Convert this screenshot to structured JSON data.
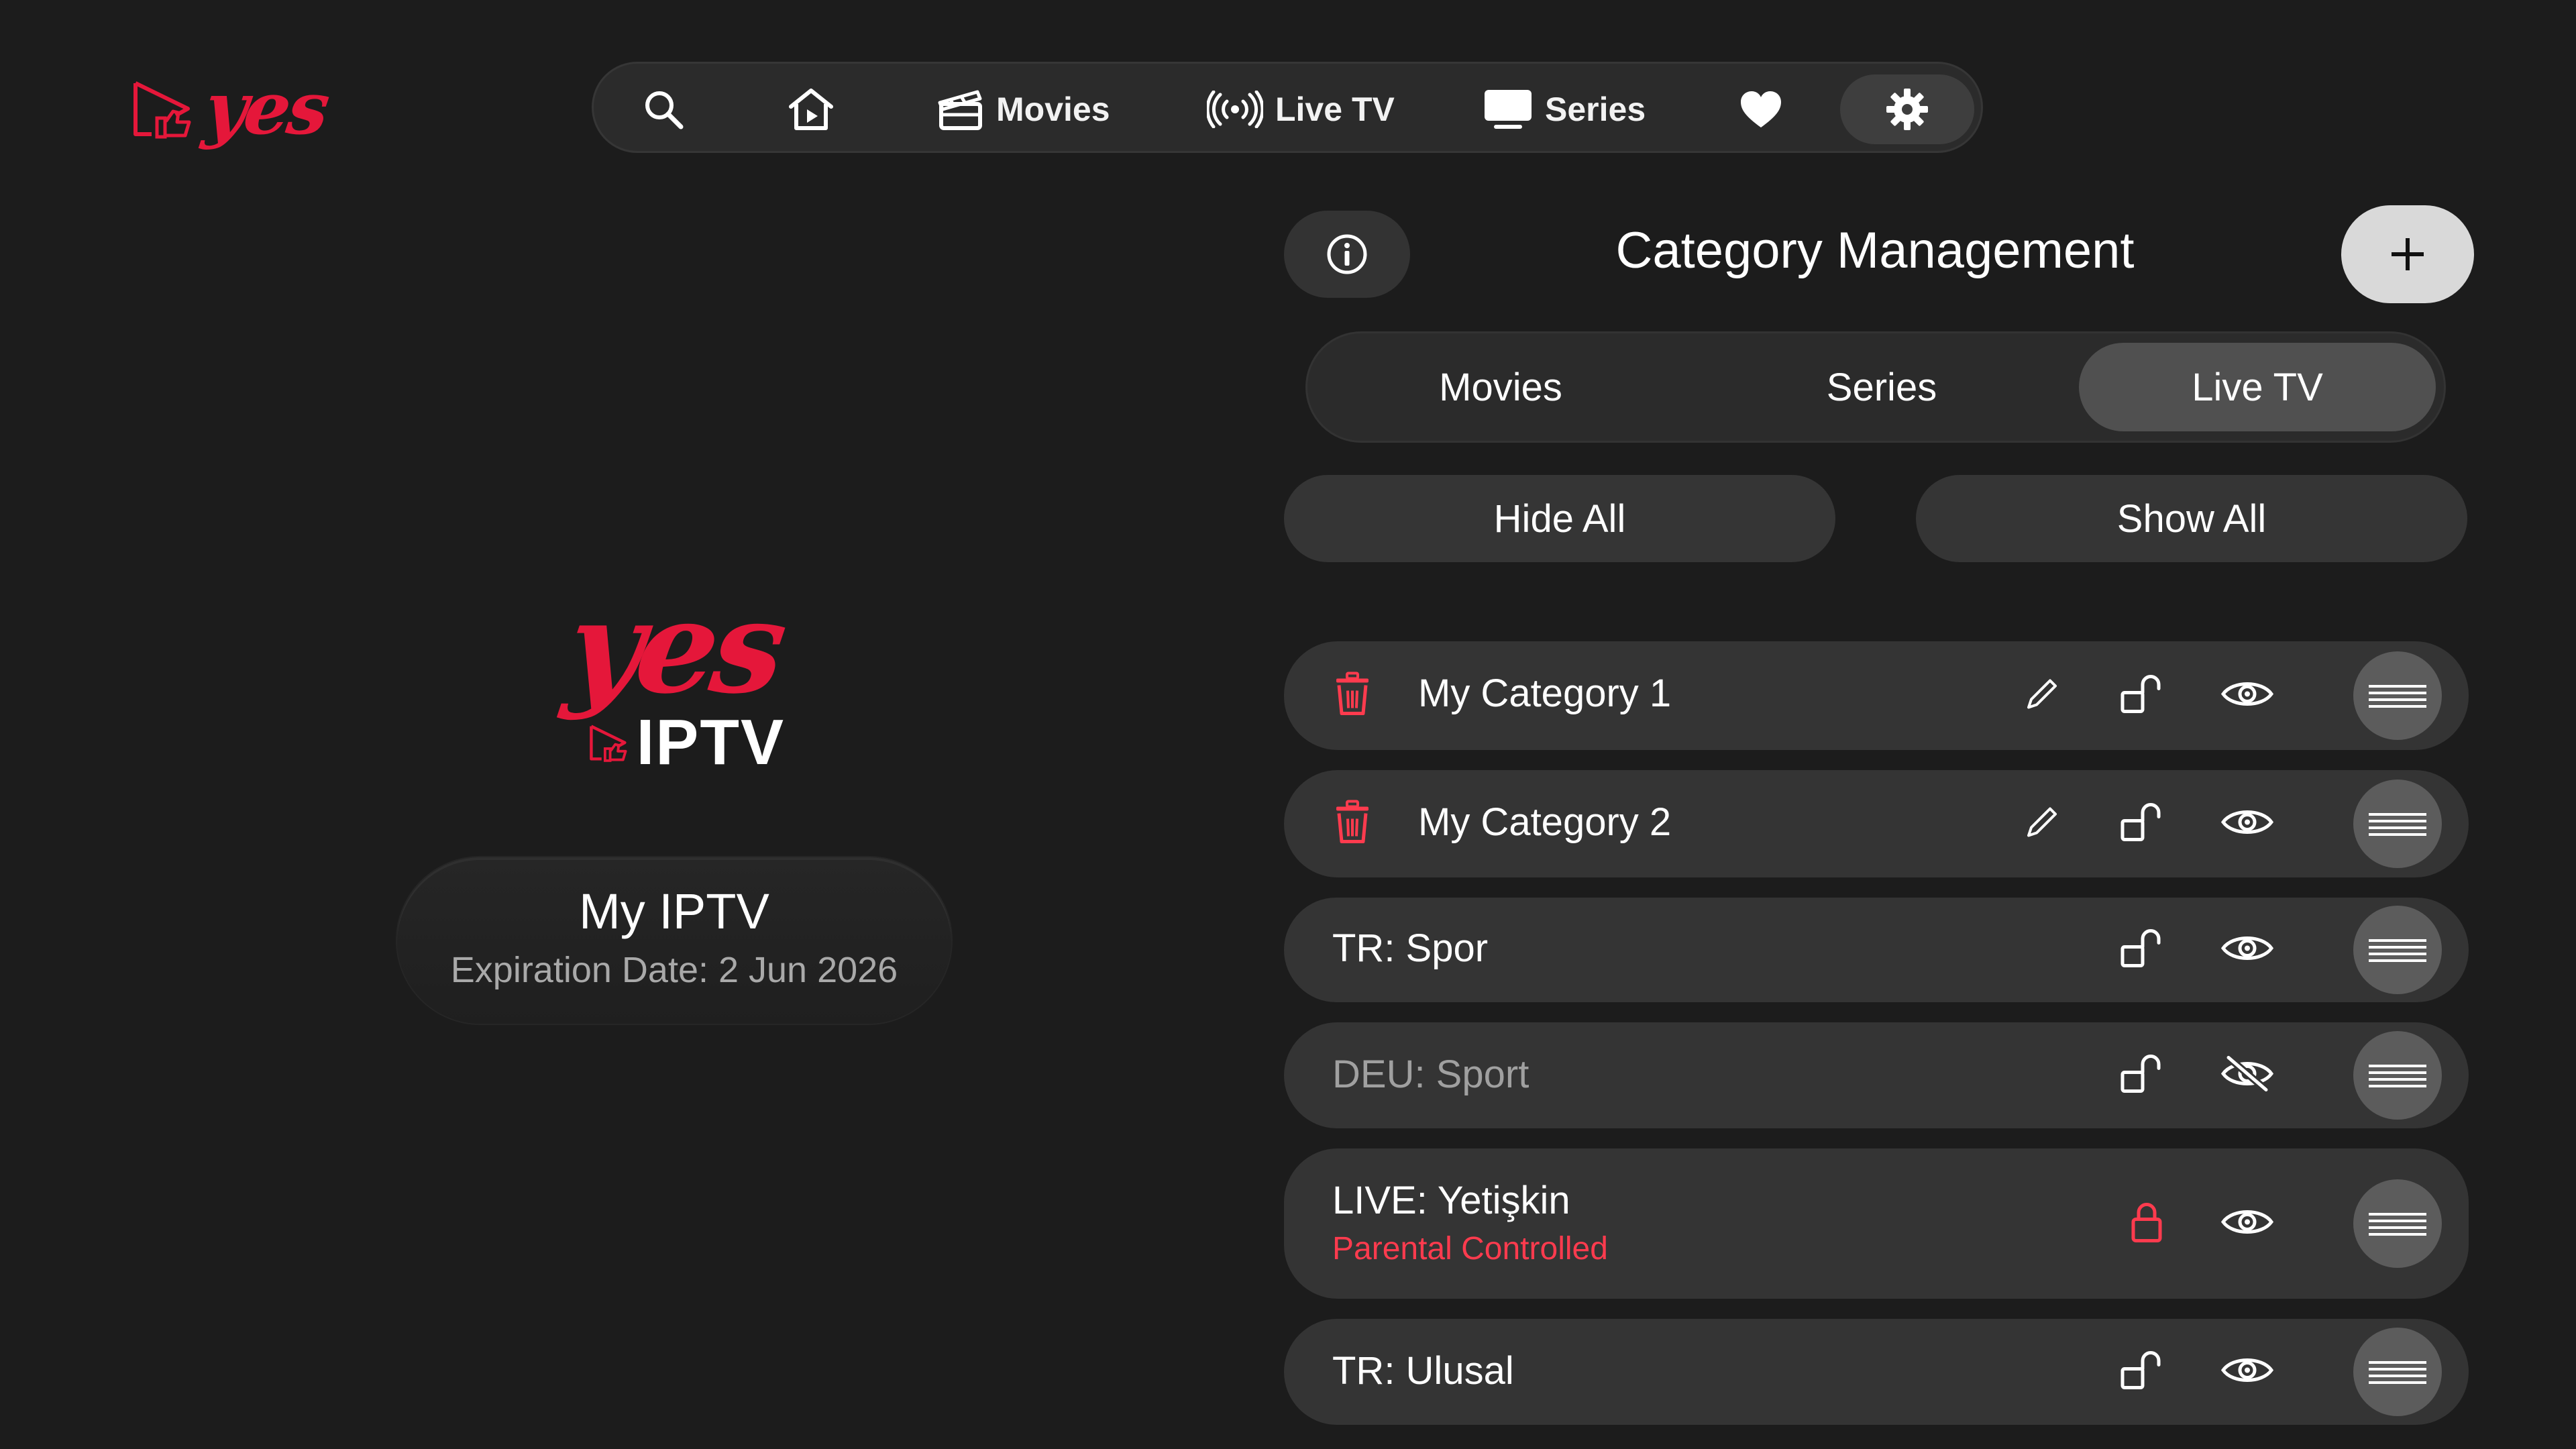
{
  "brand": {
    "wordmark": "yes",
    "product": "IPTV"
  },
  "nav": {
    "search_icon": "search-icon",
    "home_icon": "home-icon",
    "items": [
      {
        "label": "Movies",
        "icon": "clapperboard-icon"
      },
      {
        "label": "Live TV",
        "icon": "broadcast-icon"
      },
      {
        "label": "Series",
        "icon": "tv-icon"
      }
    ],
    "favorites_icon": "heart-icon",
    "settings_icon": "gear-icon"
  },
  "account": {
    "name": "My IPTV",
    "expiration": "Expiration Date: 2 Jun 2026"
  },
  "panel": {
    "title": "Category Management",
    "tabs": [
      {
        "label": "Movies",
        "active": false
      },
      {
        "label": "Series",
        "active": false
      },
      {
        "label": "Live TV",
        "active": true
      }
    ],
    "hide_all": "Hide All",
    "show_all": "Show All"
  },
  "categories": [
    {
      "name": "My Category 1",
      "deletable": true,
      "editable": true,
      "locked": false,
      "visible": true
    },
    {
      "name": "My Category 2",
      "deletable": true,
      "editable": true,
      "locked": false,
      "visible": true
    },
    {
      "name": "TR: Spor",
      "deletable": false,
      "editable": false,
      "locked": false,
      "visible": true
    },
    {
      "name": "DEU: Sport",
      "deletable": false,
      "editable": false,
      "locked": false,
      "visible": false
    },
    {
      "name": "LIVE: Yetişkin",
      "subtitle": "Parental Controlled",
      "deletable": false,
      "editable": false,
      "locked": true,
      "visible": true
    },
    {
      "name": "TR: Ulusal",
      "deletable": false,
      "editable": false,
      "locked": false,
      "visible": true
    }
  ],
  "colors": {
    "accent": "#e5173a",
    "background": "#1c1c1c",
    "row": "#343434",
    "warning": "#ff3b4e"
  }
}
